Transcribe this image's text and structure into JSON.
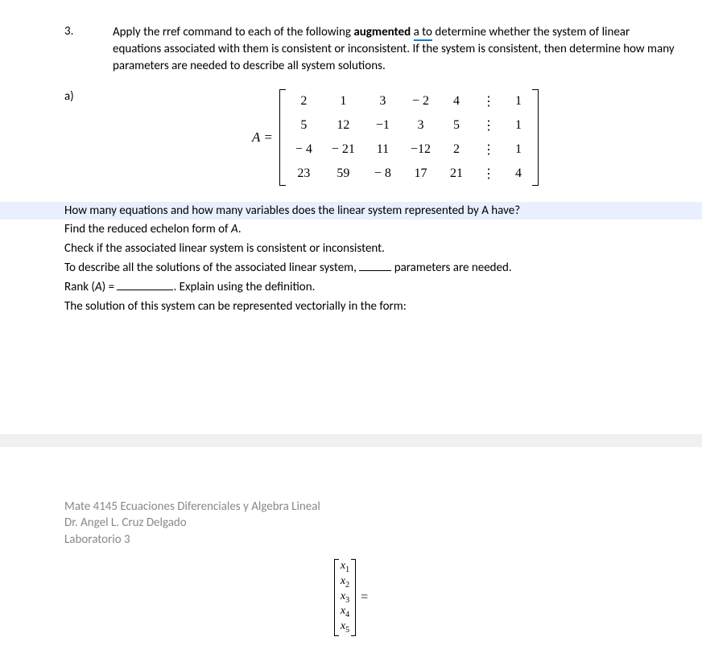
{
  "question": {
    "number": "3.",
    "text_parts": {
      "p1": "Apply the ",
      "rref": "rref",
      "p2": " command to each of the following ",
      "aug": "augmented",
      "sp": " ",
      "ato": "a  to",
      "p3": " determine whether the system of linear equations associated with them is consistent or inconsistent.  If the system is consistent, then determine how many parameters are needed to describe all system solutions."
    }
  },
  "part_a": {
    "label": "a)",
    "matrix_label": "A =",
    "matrix": {
      "rows": [
        [
          "2",
          "1",
          "3",
          "− 2",
          "4",
          "⋮",
          "1"
        ],
        [
          "5",
          "12",
          "−1",
          "3",
          "5",
          "⋮",
          "1"
        ],
        [
          "− 4",
          "− 21",
          "11",
          "−12",
          "2",
          "⋮",
          "1"
        ],
        [
          "23",
          "59",
          "− 8",
          "17",
          "21",
          "⋮",
          "4"
        ]
      ]
    }
  },
  "prompts": {
    "p1": "How many equations and how many variables does the linear system represented by A have?",
    "p2a": "Find the reduced echelon form of ",
    "p2b": "A",
    "p2c": ".",
    "p3": "Check if the associated linear system is consistent or inconsistent.",
    "p4a": "To describe all the solutions of the associated linear system, ",
    "p4b": " parameters are needed.",
    "p5a": "Rank (",
    "p5b": "A",
    "p5c": ") = ",
    "p5d": ". Explain using the definition.",
    "p6": "The solution of this system can be represented vectorially in the form:"
  },
  "footer": {
    "line1": "Mate 4145 Ecuaciones Diferenciales y Algebra Lineal",
    "line2": "Dr. Angel  L. Cruz Delgado",
    "line3": "Laboratorio 3"
  },
  "vector": {
    "items": [
      "x1",
      "x2",
      "x3",
      "x4",
      "x5"
    ],
    "eq": "="
  }
}
